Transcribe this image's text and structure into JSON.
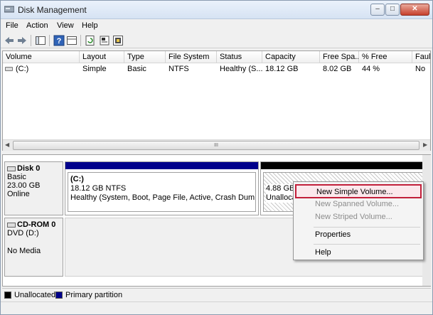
{
  "window": {
    "title": "Disk Management"
  },
  "caption_buttons": {
    "minimize": "–",
    "maximize": "□",
    "close": "✕"
  },
  "menu": [
    "File",
    "Action",
    "View",
    "Help"
  ],
  "toolbar": {
    "icons": [
      "back-arrow-icon",
      "forward-arrow-icon",
      "console-tree-icon",
      "help-icon",
      "show-pane-icon",
      "refresh-icon",
      "properties-icon",
      "rescan-icon"
    ]
  },
  "volume_list": {
    "columns": [
      "Volume",
      "Layout",
      "Type",
      "File System",
      "Status",
      "Capacity",
      "Free Spa...",
      "% Free",
      "Fault"
    ],
    "rows": [
      {
        "volume": "(C:)",
        "layout": "Simple",
        "type": "Basic",
        "fs": "NTFS",
        "status": "Healthy (S...",
        "capacity": "18.12 GB",
        "free": "8.02 GB",
        "pct_free": "44 %",
        "fault": "No"
      }
    ],
    "scroll_grip": "III"
  },
  "disks": [
    {
      "name": "Disk 0",
      "type": "Basic",
      "size": "23.00 GB",
      "state": "Online"
    },
    {
      "name": "CD-ROM 0",
      "type": "DVD (D:)",
      "size": "",
      "state": "No Media"
    }
  ],
  "partitions": {
    "c": {
      "label": "(C:)",
      "size_fs": "18.12 GB NTFS",
      "status": "Healthy (System, Boot, Page File, Active, Crash Dump, Prim",
      "color": "#00008b"
    },
    "unallocated": {
      "size": "4.88 GB",
      "status": "Unallocat",
      "color": "#000000"
    }
  },
  "legend": [
    {
      "label": "Unallocated",
      "color": "#000000"
    },
    {
      "label": "Primary partition",
      "color": "#00008b"
    }
  ],
  "context_menu": {
    "items": [
      {
        "label": "New Simple Volume...",
        "enabled": true,
        "highlighted": true
      },
      {
        "label": "New Spanned Volume...",
        "enabled": false
      },
      {
        "label": "New Striped Volume...",
        "enabled": false
      },
      {
        "label": "Properties",
        "enabled": true
      },
      {
        "label": "Help",
        "enabled": true
      }
    ]
  }
}
